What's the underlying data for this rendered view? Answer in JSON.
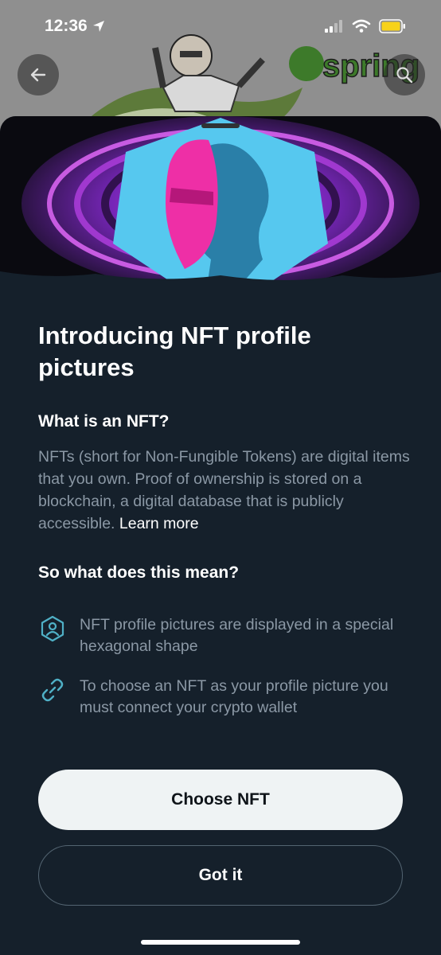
{
  "status_bar": {
    "time": "12:36"
  },
  "background_banner": {
    "brand_text": "spring"
  },
  "sheet": {
    "title": "Introducing NFT profile pictures",
    "what_heading": "What is an NFT?",
    "what_body": "NFTs (short for Non-Fungible Tokens) are digital items that you own. Proof of ownership is stored on a blockchain, a digital database that is publicly accessible.",
    "learn_more": "Learn more",
    "mean_heading": "So what does this mean?",
    "bullets": [
      {
        "icon": "hexagon-profile-icon",
        "text": "NFT profile pictures are displayed in a special hexagonal shape"
      },
      {
        "icon": "link-icon",
        "text": "To choose an NFT as your profile picture you must connect your crypto wallet"
      }
    ],
    "primary_button": "Choose NFT",
    "secondary_button": "Got it"
  },
  "colors": {
    "sheet_bg": "#15202b",
    "body_text": "#8b98a5",
    "icon_accent": "#1d9bf0",
    "primary_button_bg": "#eff3f4"
  }
}
